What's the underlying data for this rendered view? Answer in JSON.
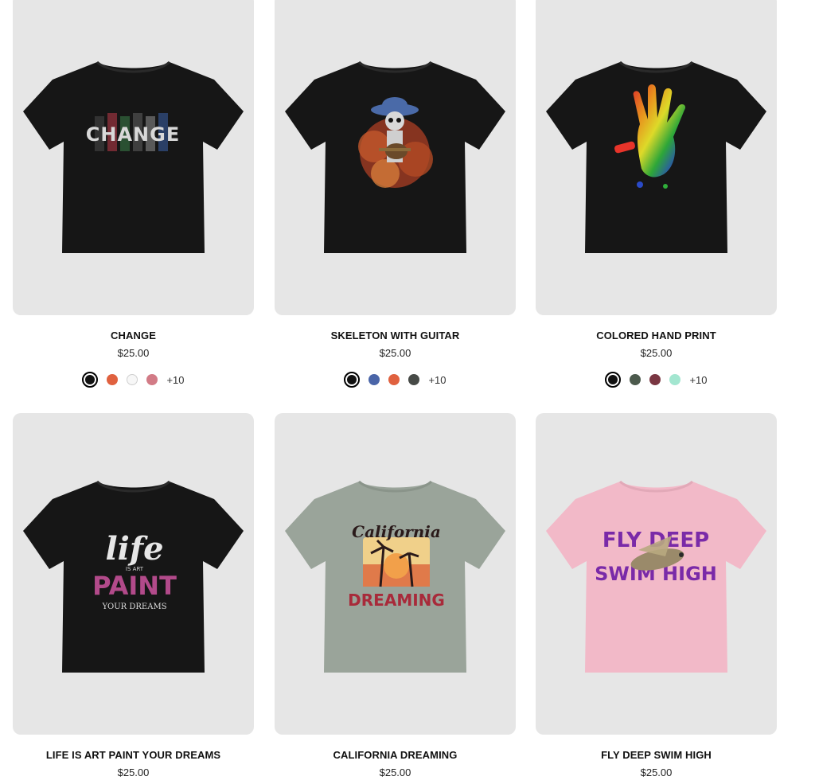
{
  "products": [
    {
      "title": "CHANGE",
      "price": "$25.00",
      "shirt_color": "#161616",
      "design_text": "CHANGE",
      "swatches": [
        "#111111",
        "#e0613f",
        "#f7f7f7",
        "#d27b86"
      ],
      "more": "+10"
    },
    {
      "title": "SKELETON WITH GUITAR",
      "price": "$25.00",
      "shirt_color": "#161616",
      "swatches": [
        "#111111",
        "#4a65a8",
        "#e0613f",
        "#474a47"
      ],
      "more": "+10"
    },
    {
      "title": "COLORED HAND PRINT",
      "price": "$25.00",
      "shirt_color": "#161616",
      "swatches": [
        "#111111",
        "#4c5a4d",
        "#7a3642",
        "#a3e6d0"
      ],
      "more": "+10"
    },
    {
      "title": "LIFE IS ART PAINT YOUR DREAMS",
      "price": "$25.00",
      "shirt_color": "#161616",
      "design_lines": [
        "life",
        "IS ART",
        "PAINT",
        "YOUR DREAMS"
      ]
    },
    {
      "title": "CALIFORNIA DREAMING",
      "price": "$25.00",
      "shirt_color": "#9aa49a",
      "design_lines": [
        "California",
        "DREAMING"
      ]
    },
    {
      "title": "FLY DEEP SWIM HIGH",
      "price": "$25.00",
      "shirt_color": "#f2b9c8",
      "design_lines": [
        "FLY DEEP",
        "SWIM HIGH"
      ]
    }
  ]
}
